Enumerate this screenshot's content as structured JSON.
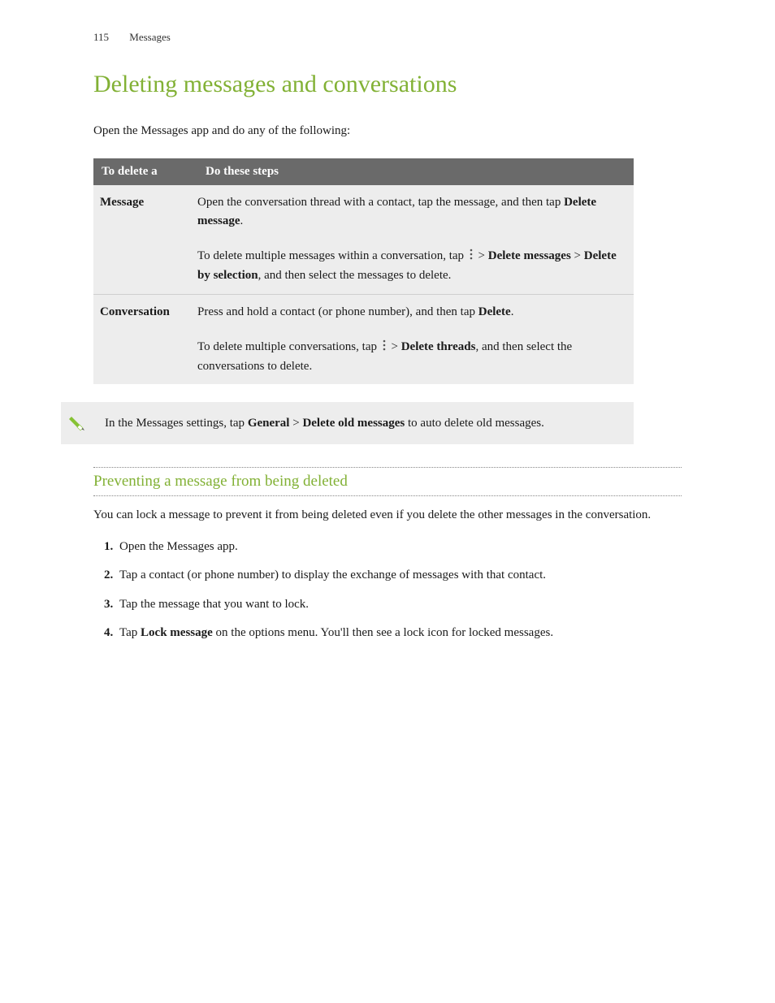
{
  "header": {
    "page_number": "115",
    "section": "Messages"
  },
  "title": "Deleting messages and conversations",
  "intro": "Open the Messages app and do any of the following:",
  "table": {
    "headers": [
      "To delete a",
      "Do these steps"
    ],
    "rows": {
      "message": {
        "label": "Message",
        "p1_pre": "Open the conversation thread with a contact, tap the message, and then tap ",
        "p1_bold": "Delete message",
        "p1_post": ".",
        "p2_pre": "To delete multiple messages within a conversation, tap ",
        "p2_gt1": " > ",
        "p2_bold1": "Delete messages",
        "p2_gt2": " > ",
        "p2_bold2": "Delete by selection",
        "p2_post": ", and then select the messages to delete."
      },
      "conversation": {
        "label": "Conversation",
        "p1_pre": "Press and hold a contact (or phone number), and then tap ",
        "p1_bold": "Delete",
        "p1_post": ".",
        "p2_pre": "To delete multiple conversations, tap ",
        "p2_gt1": " > ",
        "p2_bold1": "Delete threads",
        "p2_post": ", and then select the conversations to delete."
      }
    }
  },
  "callout": {
    "pre": "In the Messages settings, tap ",
    "bold1": "General",
    "mid": " > ",
    "bold2": "Delete old messages",
    "post": " to auto delete old messages."
  },
  "sub_title": "Preventing a message from being deleted",
  "sub_intro": "You can lock a message to prevent it from being deleted even if you delete the other messages in the conversation.",
  "steps": [
    {
      "text": "Open the Messages app."
    },
    {
      "text": "Tap a contact (or phone number) to display the exchange of messages with that contact."
    },
    {
      "text": "Tap the message that you want to lock."
    },
    {
      "pre": "Tap ",
      "bold": "Lock message",
      "post": " on the options menu. You'll then see a lock icon for locked messages."
    }
  ],
  "icons": {
    "more": "more-vert-icon",
    "tip": "pencil-tip-icon"
  }
}
